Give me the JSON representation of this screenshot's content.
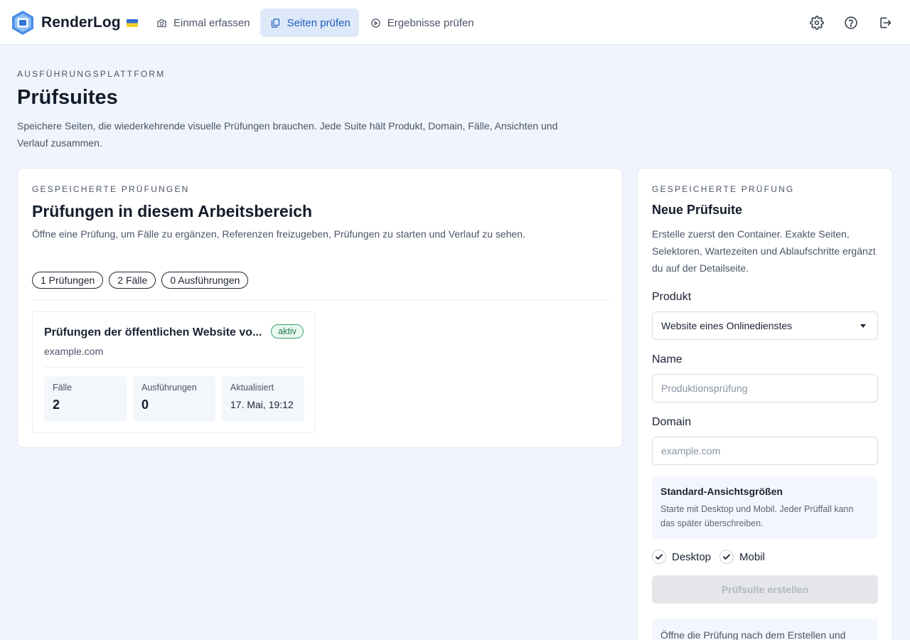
{
  "header": {
    "brand": "RenderLog",
    "nav": [
      {
        "label": "Einmal erfassen",
        "icon": "camera-icon",
        "active": false
      },
      {
        "label": "Seiten prüfen",
        "icon": "copy-icon",
        "active": true
      },
      {
        "label": "Ergebnisse prüfen",
        "icon": "play-circle-icon",
        "active": false
      }
    ],
    "actions": [
      "gear-icon",
      "help-icon",
      "logout-icon"
    ]
  },
  "page": {
    "eyebrow": "AUSFÜHRUNGSPLATTFORM",
    "title": "Prüfsuites",
    "description": "Speichere Seiten, die wiederkehrende visuelle Prüfungen brauchen. Jede Suite hält Produkt, Domain, Fälle, Ansichten und Verlauf zusammen."
  },
  "saved": {
    "eyebrow": "GESPEICHERTE PRÜFUNGEN",
    "title": "Prüfungen in diesem Arbeitsbereich",
    "description": "Öffne eine Prüfung, um Fälle zu ergänzen, Referenzen freizugeben, Prüfungen zu starten und Verlauf zu sehen.",
    "pills": [
      "1 Prüfungen",
      "2 Fälle",
      "0 Ausführungen"
    ],
    "suite": {
      "title": "Prüfungen der öffentlichen Website vo...",
      "status": "aktiv",
      "domain": "example.com",
      "stats": {
        "cases_label": "Fälle",
        "cases_value": "2",
        "runs_label": "Ausführungen",
        "runs_value": "0",
        "updated_label": "Aktualisiert",
        "updated_value": "17. Mai, 19:12"
      }
    }
  },
  "form": {
    "eyebrow": "GESPEICHERTE PRÜFUNG",
    "title": "Neue Prüfsuite",
    "description": "Erstelle zuerst den Container. Exakte Seiten, Selektoren, Wartezeiten und Ablaufschritte ergänzt du auf der Detailseite.",
    "product_label": "Produkt",
    "product_value": "Website eines Onlinedienstes",
    "name_label": "Name",
    "name_placeholder": "Produktionsprüfung",
    "domain_label": "Domain",
    "domain_placeholder": "example.com",
    "viewport_title": "Standard-Ansichtsgrößen",
    "viewport_text": "Starte mit Desktop und Mobil. Jeder Prüffall kann das später überschreiben.",
    "checks": [
      {
        "label": "Desktop",
        "checked": true
      },
      {
        "label": "Mobil",
        "checked": true
      }
    ],
    "submit_label": "Prüfsuite erstellen",
    "note": "Öffne die Prüfung nach dem Erstellen und"
  },
  "colors": {
    "accent": "#1d5fbf",
    "background": "#eff4fd",
    "status_active": "#1f7a4a"
  }
}
